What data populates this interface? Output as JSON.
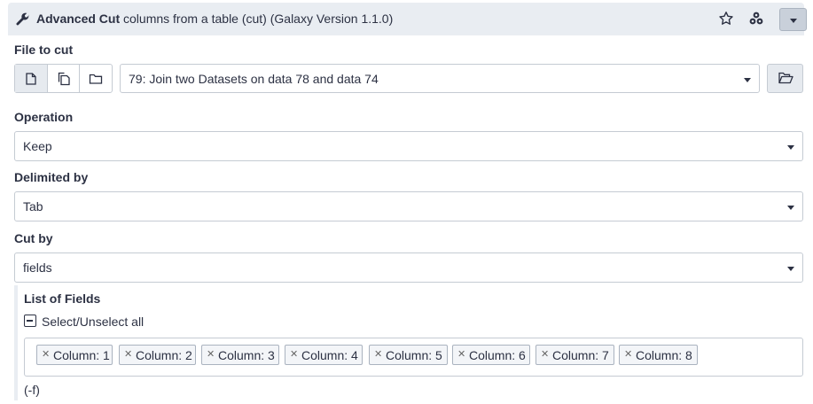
{
  "header": {
    "tool_name": "Advanced Cut",
    "tool_desc": " columns from a table (cut) (Galaxy Version 1.1.0)",
    "icons": [
      "wrench-icon",
      "star-icon",
      "share-icon",
      "caret-down-icon"
    ]
  },
  "file_to_cut": {
    "label": "File to cut",
    "value": "79: Join two Datasets on data 78 and data 74",
    "modes": [
      "single-dataset-icon",
      "multiple-datasets-icon",
      "collection-folder-icon"
    ],
    "browse_icon": "folder-open-icon"
  },
  "operation": {
    "label": "Operation",
    "value": "Keep"
  },
  "delimited_by": {
    "label": "Delimited by",
    "value": "Tab"
  },
  "cut_by": {
    "label": "Cut by",
    "value": "fields"
  },
  "list_of_fields": {
    "label": "List of Fields",
    "select_all": "Select/Unselect all",
    "tags": [
      "Column: 1",
      "Column: 2",
      "Column: 3",
      "Column: 4",
      "Column: 5",
      "Column: 6",
      "Column: 7",
      "Column: 8"
    ],
    "help": "(-f)"
  },
  "colors": {
    "header_bg": "#e9edf2",
    "text": "#2c3143",
    "border": "#c5cbd3"
  }
}
